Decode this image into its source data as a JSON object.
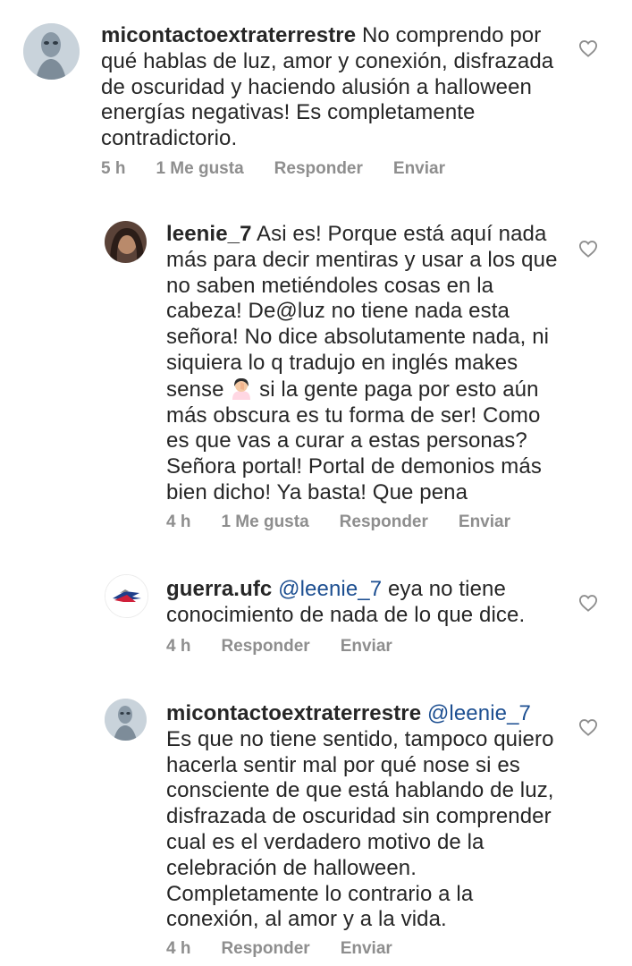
{
  "comments": [
    {
      "username": "micontactoextraterrestre",
      "mention": "",
      "text": " No comprendo por qué hablas de luz, amor y conexión, disfrazada de oscuridad y haciendo alusión a halloween energías negativas! Es completamente contradictorio.",
      "time": "5 h",
      "likes": "1 Me gusta",
      "reply": "Responder",
      "send": "Enviar"
    },
    {
      "username": "leenie_7",
      "mention": "",
      "text_part1": " Asi es! Porque está aquí nada más para decir mentiras y usar a los que no saben metiéndoles cosas en la cabeza! De@luz no tiene nada esta señora! No dice absolutamente nada, ni siquiera lo q tradujo en inglés makes sense",
      "emoji": "woman-facepalming-emoji",
      "text_part2": " si la gente paga por esto aún más obscura es tu forma de ser! Como es que vas a curar a estas personas? Señora portal! Portal de demonios más bien dicho! Ya basta! Que pena",
      "time": "4 h",
      "likes": "1 Me gusta",
      "reply": "Responder",
      "send": "Enviar"
    },
    {
      "username": "guerra.ufc",
      "mention": "@leenie_7",
      "text": " eya no tiene conocimiento de nada de lo que dice.",
      "time": "4 h",
      "reply": "Responder",
      "send": "Enviar"
    },
    {
      "username": "micontactoextraterrestre",
      "mention": "@leenie_7",
      "text": " Es que no tiene sentido, tampoco quiero hacerla sentir mal por qué nose si es consciente de que está hablando de luz, disfrazada de oscuridad sin comprender cual es el verdadero motivo de la celebración de halloween. Completamente lo contrario a la conexión, al amor y a la vida.",
      "time": "4 h",
      "reply": "Responder",
      "send": "Enviar"
    }
  ],
  "icons": {
    "like": "heart-outline-icon"
  },
  "colors": {
    "text": "#262626",
    "meta": "#8e8e8e",
    "mention": "#1d4f91",
    "background": "#ffffff"
  }
}
